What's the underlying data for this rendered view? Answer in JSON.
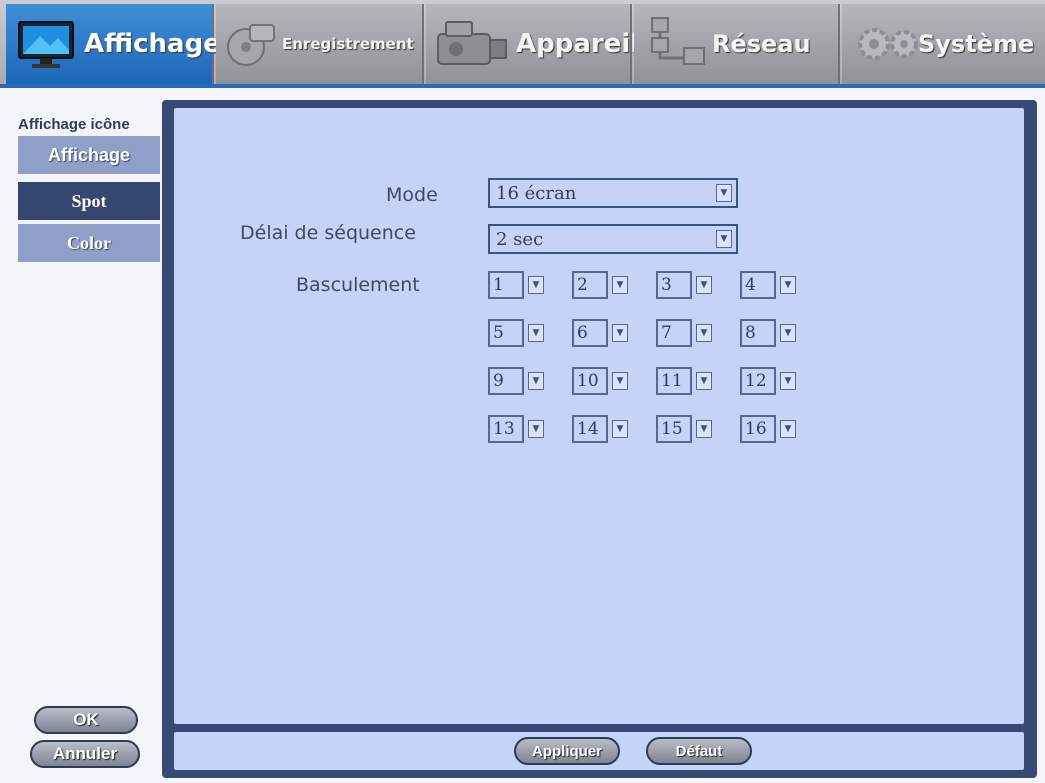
{
  "tabs": [
    {
      "label": "Affichage",
      "icon": "monitor-icon",
      "active": true
    },
    {
      "label": "Enregistrement",
      "icon": "disc-icon",
      "active": false
    },
    {
      "label": "Appareil",
      "icon": "camera-icon",
      "active": false
    },
    {
      "label": "Réseau",
      "icon": "network-icon",
      "active": false
    },
    {
      "label": "Système",
      "icon": "gears-icon",
      "active": false
    }
  ],
  "sidebar": {
    "title": "Affichage icône",
    "items": [
      {
        "label": "Affichage"
      },
      {
        "label": "Spot"
      },
      {
        "label": "Color"
      }
    ],
    "ok_label": "OK",
    "cancel_label": "Annuler"
  },
  "form": {
    "mode_label": "Mode",
    "mode_value": "16 écran",
    "sequence_label": "Délai de séquence",
    "sequence_value": "2 sec",
    "switch_label": "Basculement",
    "switch_values": [
      "1",
      "2",
      "3",
      "4",
      "5",
      "6",
      "7",
      "8",
      "9",
      "10",
      "11",
      "12",
      "13",
      "14",
      "15",
      "16"
    ]
  },
  "footer": {
    "apply_label": "Appliquer",
    "default_label": "Défaut"
  },
  "colors": {
    "active_tab": "#1d67b7",
    "panel": "#c4d3f6",
    "frame": "#384a73",
    "sidebar_current": "#35466f",
    "sidebar_inactive": "#8f9fc7"
  }
}
